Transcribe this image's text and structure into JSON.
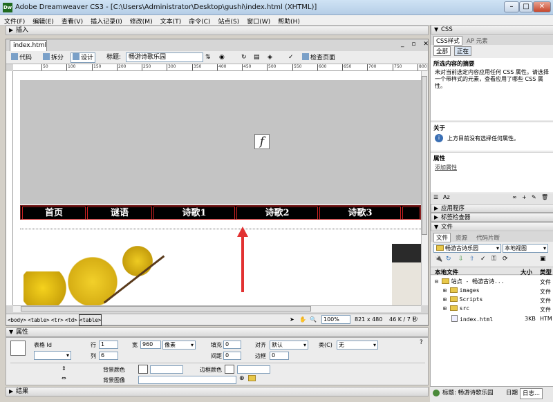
{
  "window": {
    "title": "Adobe Dreamweaver CS3 - [C:\\Users\\Administrator\\Desktop\\gushi\\index.html (XHTML)]",
    "app_icon": "Dw"
  },
  "menu": [
    "文件(F)",
    "编辑(E)",
    "查看(V)",
    "插入记录(I)",
    "修改(M)",
    "文本(T)",
    "命令(C)",
    "站点(S)",
    "窗口(W)",
    "帮助(H)"
  ],
  "insert_panel": "插入",
  "document": {
    "tab": "index.html",
    "views": {
      "code": "代码",
      "split": "拆分",
      "design": "设计"
    },
    "title_label": "标题:",
    "title_value": "畅游诗歌乐园",
    "check_page": "检查页面",
    "ruler_ticks": [
      "50",
      "100",
      "150",
      "200",
      "250",
      "300",
      "350",
      "400",
      "450",
      "500",
      "550",
      "600",
      "650",
      "700",
      "750",
      "800"
    ],
    "nav_items": [
      "首页",
      "谜语",
      "诗歌1",
      "诗歌2",
      "诗歌3"
    ],
    "tag_path": [
      "<body>",
      "<table>",
      "<tr>",
      "<td>",
      "<table>"
    ],
    "zoom": "100%",
    "dimensions": "821 x 480",
    "size": "46 K / 7 秒"
  },
  "properties": {
    "header": "属性",
    "table_label": "表格 Id",
    "rows_label": "行",
    "rows_value": "1",
    "cols_label": "列",
    "cols_value": "6",
    "width_label": "宽",
    "width_value": "960",
    "width_unit": "像素",
    "padding_label": "填充",
    "padding_value": "0",
    "spacing_label": "间距",
    "spacing_value": "0",
    "align_label": "对齐",
    "align_value": "默认",
    "border_label": "边框",
    "border_value": "0",
    "class_label": "类(C)",
    "class_value": "无",
    "bgcolor_label": "背景颜色",
    "bordercolor_label": "边框颜色",
    "bgimage_label": "背景图像"
  },
  "results_panel": "结果",
  "css_panel": {
    "header": "CSS",
    "tabs": [
      "CSS样式",
      "AP 元素"
    ],
    "modes": [
      "全部",
      "正在"
    ],
    "summary_title": "所选内容的摘要",
    "summary_text": "未对当前选定内容应用任何 CSS 属性。请选择一个带样式的元素，查看应用了哪些 CSS 属性。",
    "about_title": "关于",
    "about_text": "上方目前没有选择任何属性。",
    "props_title": "属性",
    "add_property": "添加属性"
  },
  "app_panel": "应用程序",
  "tag_inspector": "标签检查器",
  "files_panel": {
    "header": "文件",
    "tabs": [
      "文件",
      "资源",
      "代码片断"
    ],
    "site": "畅游古诗乐园",
    "view": "本地视图",
    "col_local": "本地文件",
    "col_size": "大小",
    "col_type": "类型",
    "rows": [
      {
        "name": "站点 - 畅游古诗...",
        "size": "",
        "type": "文件"
      },
      {
        "name": "images",
        "size": "",
        "type": "文件"
      },
      {
        "name": "Scripts",
        "size": "",
        "type": "文件"
      },
      {
        "name": "src",
        "size": "",
        "type": "文件"
      },
      {
        "name": "index.html",
        "size": "3KB",
        "type": "HTM"
      }
    ]
  },
  "status_bottom": {
    "title": "标题: 畅游诗歌乐园",
    "date": "日期",
    "log": "日志..."
  }
}
